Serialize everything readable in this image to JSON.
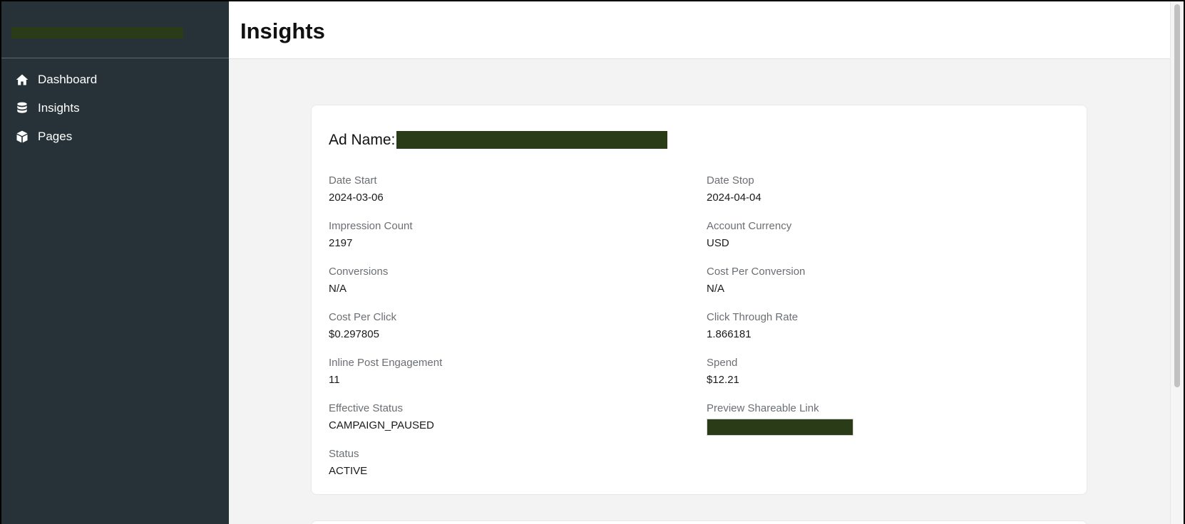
{
  "sidebar": {
    "items": [
      {
        "label": "Dashboard",
        "icon": "home-icon"
      },
      {
        "label": "Insights",
        "icon": "database-icon"
      },
      {
        "label": "Pages",
        "icon": "cube-icon"
      }
    ]
  },
  "header": {
    "title": "Insights"
  },
  "card": {
    "ad_name_label": "Ad Name:",
    "fields": {
      "date_start": {
        "label": "Date Start",
        "value": "2024-03-06"
      },
      "date_stop": {
        "label": "Date Stop",
        "value": "2024-04-04"
      },
      "impression_count": {
        "label": "Impression Count",
        "value": "2197"
      },
      "account_currency": {
        "label": "Account Currency",
        "value": "USD"
      },
      "conversions": {
        "label": "Conversions",
        "value": "N/A"
      },
      "cost_per_conversion": {
        "label": "Cost Per Conversion",
        "value": "N/A"
      },
      "cost_per_click": {
        "label": "Cost Per Click",
        "value": "$0.297805"
      },
      "click_through_rate": {
        "label": "Click Through Rate",
        "value": "1.866181"
      },
      "inline_post_engagement": {
        "label": "Inline Post Engagement",
        "value": "11"
      },
      "spend": {
        "label": "Spend",
        "value": "$12.21"
      },
      "effective_status": {
        "label": "Effective Status",
        "value": "CAMPAIGN_PAUSED"
      },
      "preview_shareable_link": {
        "label": "Preview Shareable Link"
      },
      "status": {
        "label": "Status",
        "value": "ACTIVE"
      }
    }
  },
  "colors": {
    "sidebar_bg": "#263238",
    "redaction": "#2a3b18",
    "content_bg": "#f3f3f3"
  }
}
